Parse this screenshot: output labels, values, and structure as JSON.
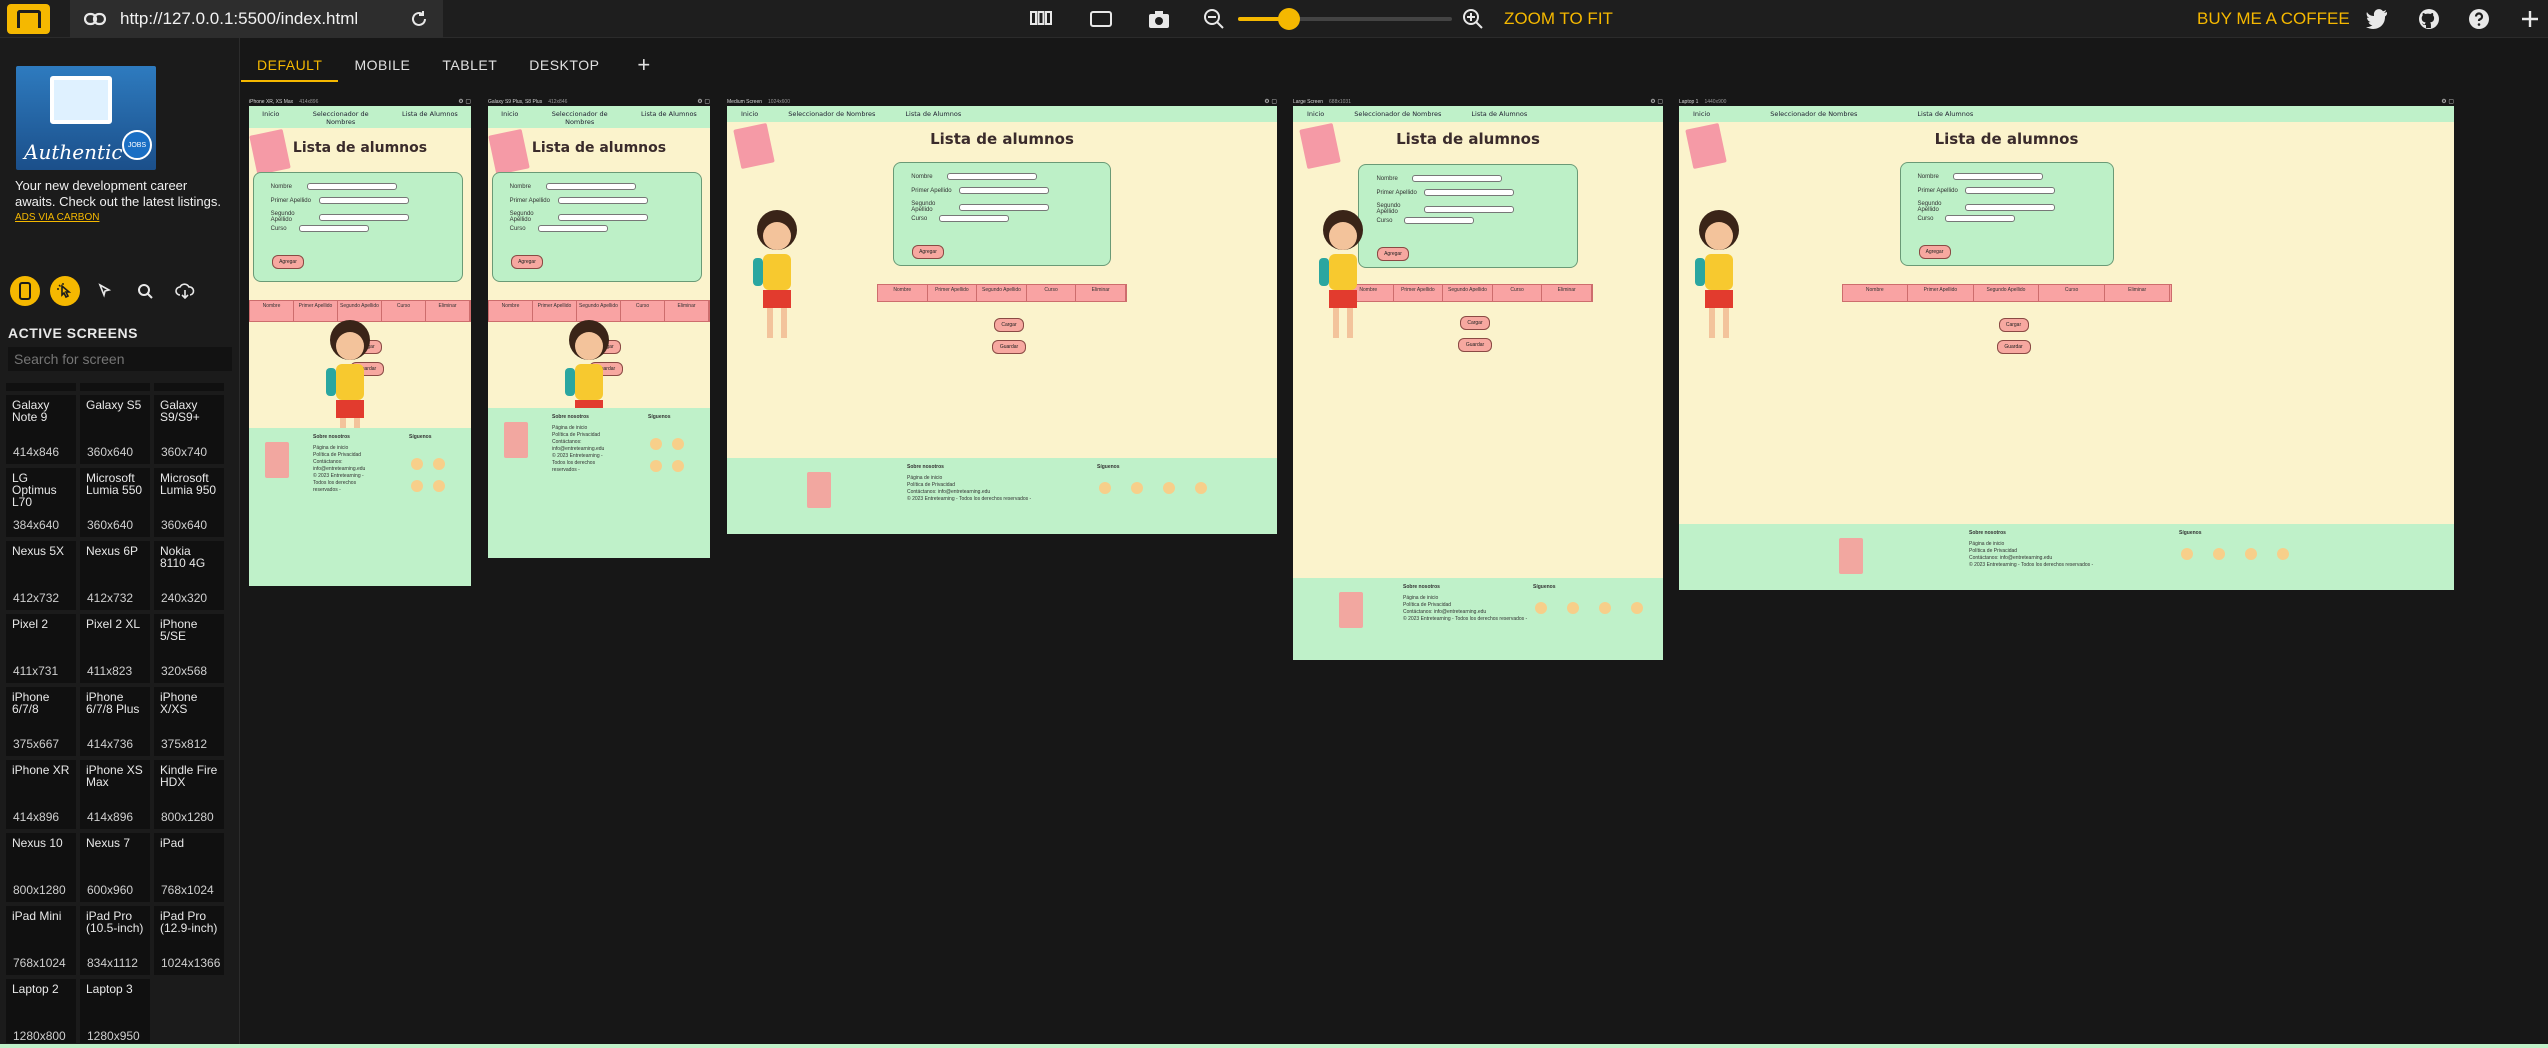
{
  "app": {
    "url": "http://127.0.0.1:5500/index.html",
    "zoom_fit_label": "ZOOM TO FIT",
    "coffee_label": "BUY ME A COFFEE",
    "zoom_level": 0.2
  },
  "sidebar": {
    "ad_brand": "Authentic",
    "ad_badge": "JOBS",
    "ad_text": "Your new development career awaits. Check out the latest listings.",
    "ad_link": "ADS VIA CARBON",
    "active_screens_title": "ACTIVE SCREENS",
    "search_placeholder": "Search for screen",
    "devices": [
      {
        "name": "Galaxy Note 9",
        "dims": "414x846"
      },
      {
        "name": "Galaxy S5",
        "dims": "360x640"
      },
      {
        "name": "Galaxy S9/S9+",
        "dims": "360x740"
      },
      {
        "name": "LG Optimus L70",
        "dims": "384x640"
      },
      {
        "name": "Microsoft Lumia 550",
        "dims": "360x640"
      },
      {
        "name": "Microsoft Lumia 950",
        "dims": "360x640"
      },
      {
        "name": "Nexus 5X",
        "dims": "412x732"
      },
      {
        "name": "Nexus 6P",
        "dims": "412x732"
      },
      {
        "name": "Nokia 8110 4G",
        "dims": "240x320"
      },
      {
        "name": "Pixel 2",
        "dims": "411x731"
      },
      {
        "name": "Pixel 2 XL",
        "dims": "411x823"
      },
      {
        "name": "iPhone 5/SE",
        "dims": "320x568"
      },
      {
        "name": "iPhone 6/7/8",
        "dims": "375x667"
      },
      {
        "name": "iPhone 6/7/8 Plus",
        "dims": "414x736"
      },
      {
        "name": "iPhone X/XS",
        "dims": "375x812"
      },
      {
        "name": "iPhone XR",
        "dims": "414x896"
      },
      {
        "name": "iPhone XS Max",
        "dims": "414x896"
      },
      {
        "name": "Kindle Fire HDX",
        "dims": "800x1280"
      },
      {
        "name": "Nexus 10",
        "dims": "800x1280"
      },
      {
        "name": "Nexus 7",
        "dims": "600x960"
      },
      {
        "name": "iPad",
        "dims": "768x1024"
      },
      {
        "name": "iPad Mini",
        "dims": "768x1024"
      },
      {
        "name": "iPad Pro (10.5-inch)",
        "dims": "834x1112"
      },
      {
        "name": "iPad Pro (12.9-inch)",
        "dims": "1024x1366"
      },
      {
        "name": "Laptop 2",
        "dims": "1280x800"
      },
      {
        "name": "Laptop 3",
        "dims": "1280x950"
      }
    ]
  },
  "tabs": [
    "DEFAULT",
    "MOBILE",
    "TABLET",
    "DESKTOP"
  ],
  "site": {
    "nav": [
      "Inicio",
      "Seleccionador de Nombres",
      "Lista de Alumnos"
    ],
    "title": "Lista de alumnos",
    "form_fields": [
      "Nombre",
      "Primer Apellido",
      "Segundo Apellido",
      "Curso"
    ],
    "add_button": "Agregar",
    "table_headers": [
      "Nombre",
      "Primer Apellido",
      "Segundo Apellido",
      "Curso",
      "Eliminar"
    ],
    "load_button": "Cargar",
    "save_button": "Guardar",
    "footer_about_title": "Sobre nosotros",
    "footer_links": [
      "Página de inicio",
      "Política de Privacidad",
      "Contáctanos: info@entretearning.edu",
      "© 2023 Entretearning - Todos los derechos reservados -"
    ],
    "footer_follow_title": "Síguenos"
  },
  "frames": [
    {
      "label": "iPhone XR, XS Max",
      "dims": "414x896"
    },
    {
      "label": "Galaxy S9 Plus, S8 Plus",
      "dims": "412x846"
    },
    {
      "label": "Medium Screen",
      "dims": "1024x600"
    },
    {
      "label": "Large Screen",
      "dims": "688x1031"
    },
    {
      "label": "Laptop 1",
      "dims": "1440x900"
    }
  ]
}
